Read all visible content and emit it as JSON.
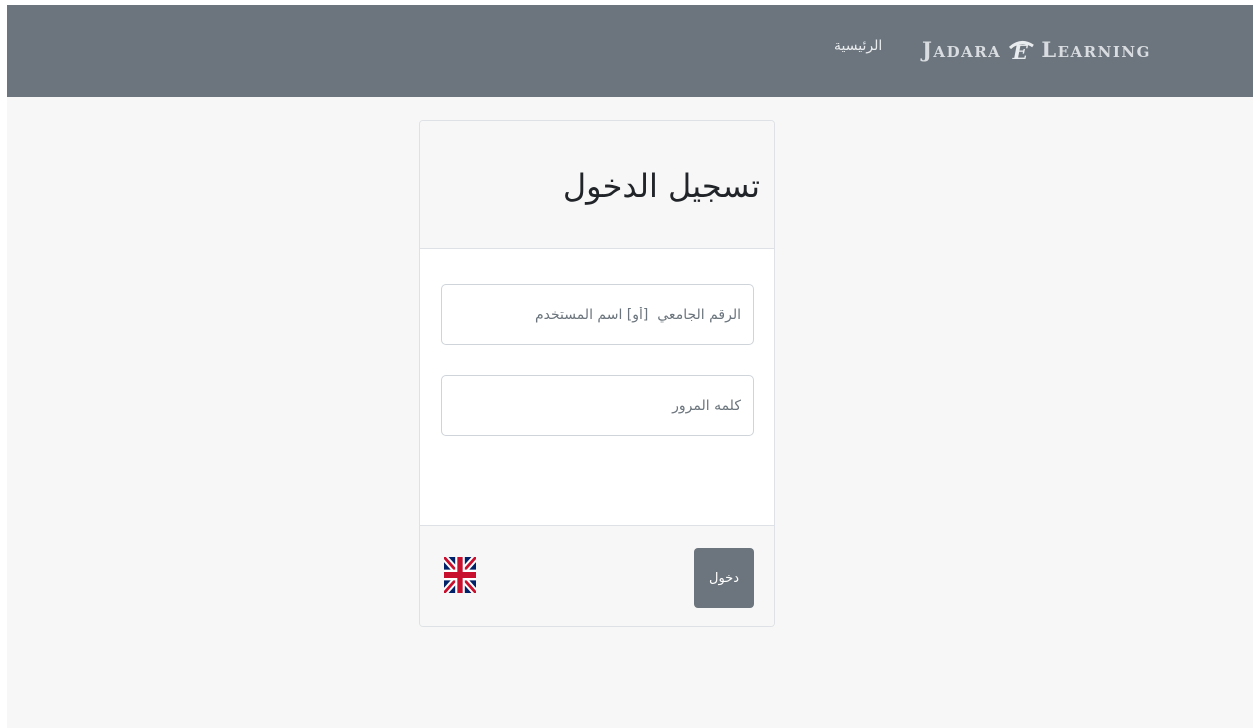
{
  "navbar": {
    "brand_word1": "Jadara",
    "brand_word2": "Learning",
    "brand_logo_icon": "e-logo-icon",
    "home_link": "الرئيسية",
    "background_color": "#6c757d"
  },
  "login_card": {
    "title": "تسجيل الدخول",
    "username": {
      "value": "",
      "placeholder": "الرقم الجامعي  [أو] اسم المستخدم"
    },
    "password": {
      "value": "",
      "placeholder": "كلمه المرور"
    },
    "submit_label": "دخول",
    "language_icon": "uk-flag-icon"
  }
}
